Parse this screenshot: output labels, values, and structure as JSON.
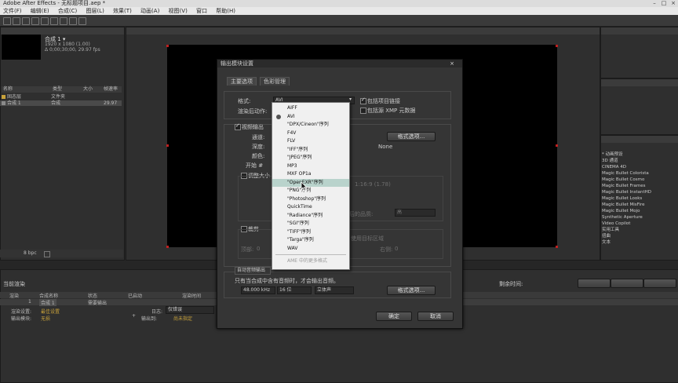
{
  "window": {
    "title": "Adobe After Effects - 无标题项目.aep *"
  },
  "menu": [
    "文件(F)",
    "编辑(E)",
    "合成(C)",
    "图层(L)",
    "效果(T)",
    "动画(A)",
    "视图(V)",
    "窗口",
    "帮助(H)"
  ],
  "project": {
    "comp_name": "合成 1 ▾",
    "comp_info1": "1920 x 1080 (1.00)",
    "comp_info2": "Δ 0;00;30;00, 29.97 fps",
    "columns": {
      "name": "名称",
      "type": "类型",
      "size": "大小",
      "framerate": "帧速率"
    },
    "rows": [
      {
        "name": "固态层",
        "type": "文件夹",
        "fps": ""
      },
      {
        "name": "合成 1",
        "type": "合成",
        "fps": "29.97"
      }
    ],
    "bpc": "8 bpc"
  },
  "dialog": {
    "title": "输出模块设置",
    "tabs": [
      "主要选项",
      "色彩管理"
    ],
    "format_label": "格式:",
    "format_value": "AVI",
    "post_render_label": "渲染后动作:",
    "include_project_link": "包括项目链接",
    "include_xmp": "包括源 XMP 元数据",
    "video_output": "视频输出",
    "channels_label": "通道:",
    "depth_label": "深度:",
    "color_label": "颜色:",
    "start_label": "开始 #",
    "format_options_btn": "格式选项...",
    "codec_value": "None",
    "resize_label": "调整大小",
    "ratio_text": "1:16:9 (1.78)",
    "resize_quality_text": "调整大小后的品质:",
    "resize_quality_value": "高",
    "crop_label": "裁剪",
    "crop_top": "顶部:",
    "crop_top_val": "0",
    "crop_right": "右侧:",
    "crop_right_val": "0",
    "crop_region_text": "使用目标区域",
    "auto_audio": "自动音频输出",
    "audio_note": "只有当合成中含有音频时，才会输出音频。",
    "sample_rate": "48.000 kHz",
    "bit_depth": "16 位",
    "channels": "立体声",
    "audio_format_btn": "格式选项...",
    "ok": "确定",
    "cancel": "取消"
  },
  "dropdown": {
    "items": [
      {
        "label": "AIFF",
        "selected": false,
        "current": false,
        "disabled": false
      },
      {
        "label": "AVI",
        "selected": false,
        "current": true,
        "disabled": false
      },
      {
        "label": "\"DPX/Cineon\"序列",
        "selected": false,
        "current": false,
        "disabled": false
      },
      {
        "label": "F4V",
        "selected": false,
        "current": false,
        "disabled": false
      },
      {
        "label": "FLV",
        "selected": false,
        "current": false,
        "disabled": false
      },
      {
        "label": "\"IFF\"序列",
        "selected": false,
        "current": false,
        "disabled": false
      },
      {
        "label": "\"JPEG\"序列",
        "selected": false,
        "current": false,
        "disabled": false
      },
      {
        "label": "MP3",
        "selected": false,
        "current": false,
        "disabled": false
      },
      {
        "label": "MXF OP1a",
        "selected": false,
        "current": false,
        "disabled": false
      },
      {
        "label": "\"OpenEXR\"序列",
        "selected": true,
        "current": false,
        "disabled": false
      },
      {
        "label": "\"PNG\"序列",
        "selected": false,
        "current": false,
        "disabled": false
      },
      {
        "label": "\"Photoshop\"序列",
        "selected": false,
        "current": false,
        "disabled": false
      },
      {
        "label": "QuickTime",
        "selected": false,
        "current": false,
        "disabled": false
      },
      {
        "label": "\"Radiance\"序列",
        "selected": false,
        "current": false,
        "disabled": false
      },
      {
        "label": "\"SGI\"序列",
        "selected": false,
        "current": false,
        "disabled": false
      },
      {
        "label": "\"TIFF\"序列",
        "selected": false,
        "current": false,
        "disabled": false
      },
      {
        "label": "\"Targa\"序列",
        "selected": false,
        "current": false,
        "disabled": false
      },
      {
        "label": "WAV",
        "selected": false,
        "current": false,
        "disabled": false
      },
      {
        "label": "AME 中的更多格式",
        "selected": false,
        "current": false,
        "disabled": true
      }
    ]
  },
  "render_queue": {
    "title": "当前渲染",
    "remaining": "剩余时间:",
    "columns": {
      "render": "渲染",
      "comp": "合成名称",
      "status": "状态",
      "started": "已启动",
      "time": "渲染时间"
    },
    "row": {
      "index": "1",
      "comp": "合成 1",
      "status": "需要输出"
    },
    "settings_label": "渲染设置:",
    "settings_value": "最佳设置",
    "output_label": "输出模块:",
    "output_value": "无损",
    "log_label": "日志:",
    "log_value": "仅错误",
    "output_to_label": "输出到:",
    "output_to_value": "尚未指定"
  },
  "effects": {
    "items": [
      "* 动画预设",
      "3D 通道",
      "CINEMA 4D",
      "Magic Bullet Colorista",
      "Magic Bullet Cosmo",
      "Magic Bullet Frames",
      "Magic Bullet InstantHD",
      "Magic Bullet Looks",
      "Magic Bullet MisFire",
      "Magic Bullet Mojo",
      "Synthetic Aperture",
      "Video Copilot",
      "实用工具",
      "扭曲",
      "文本"
    ]
  },
  "colors": {
    "accent_selected": "#b9d3cc",
    "marker": "#c02020",
    "label_yellow": "#c8a23a"
  }
}
